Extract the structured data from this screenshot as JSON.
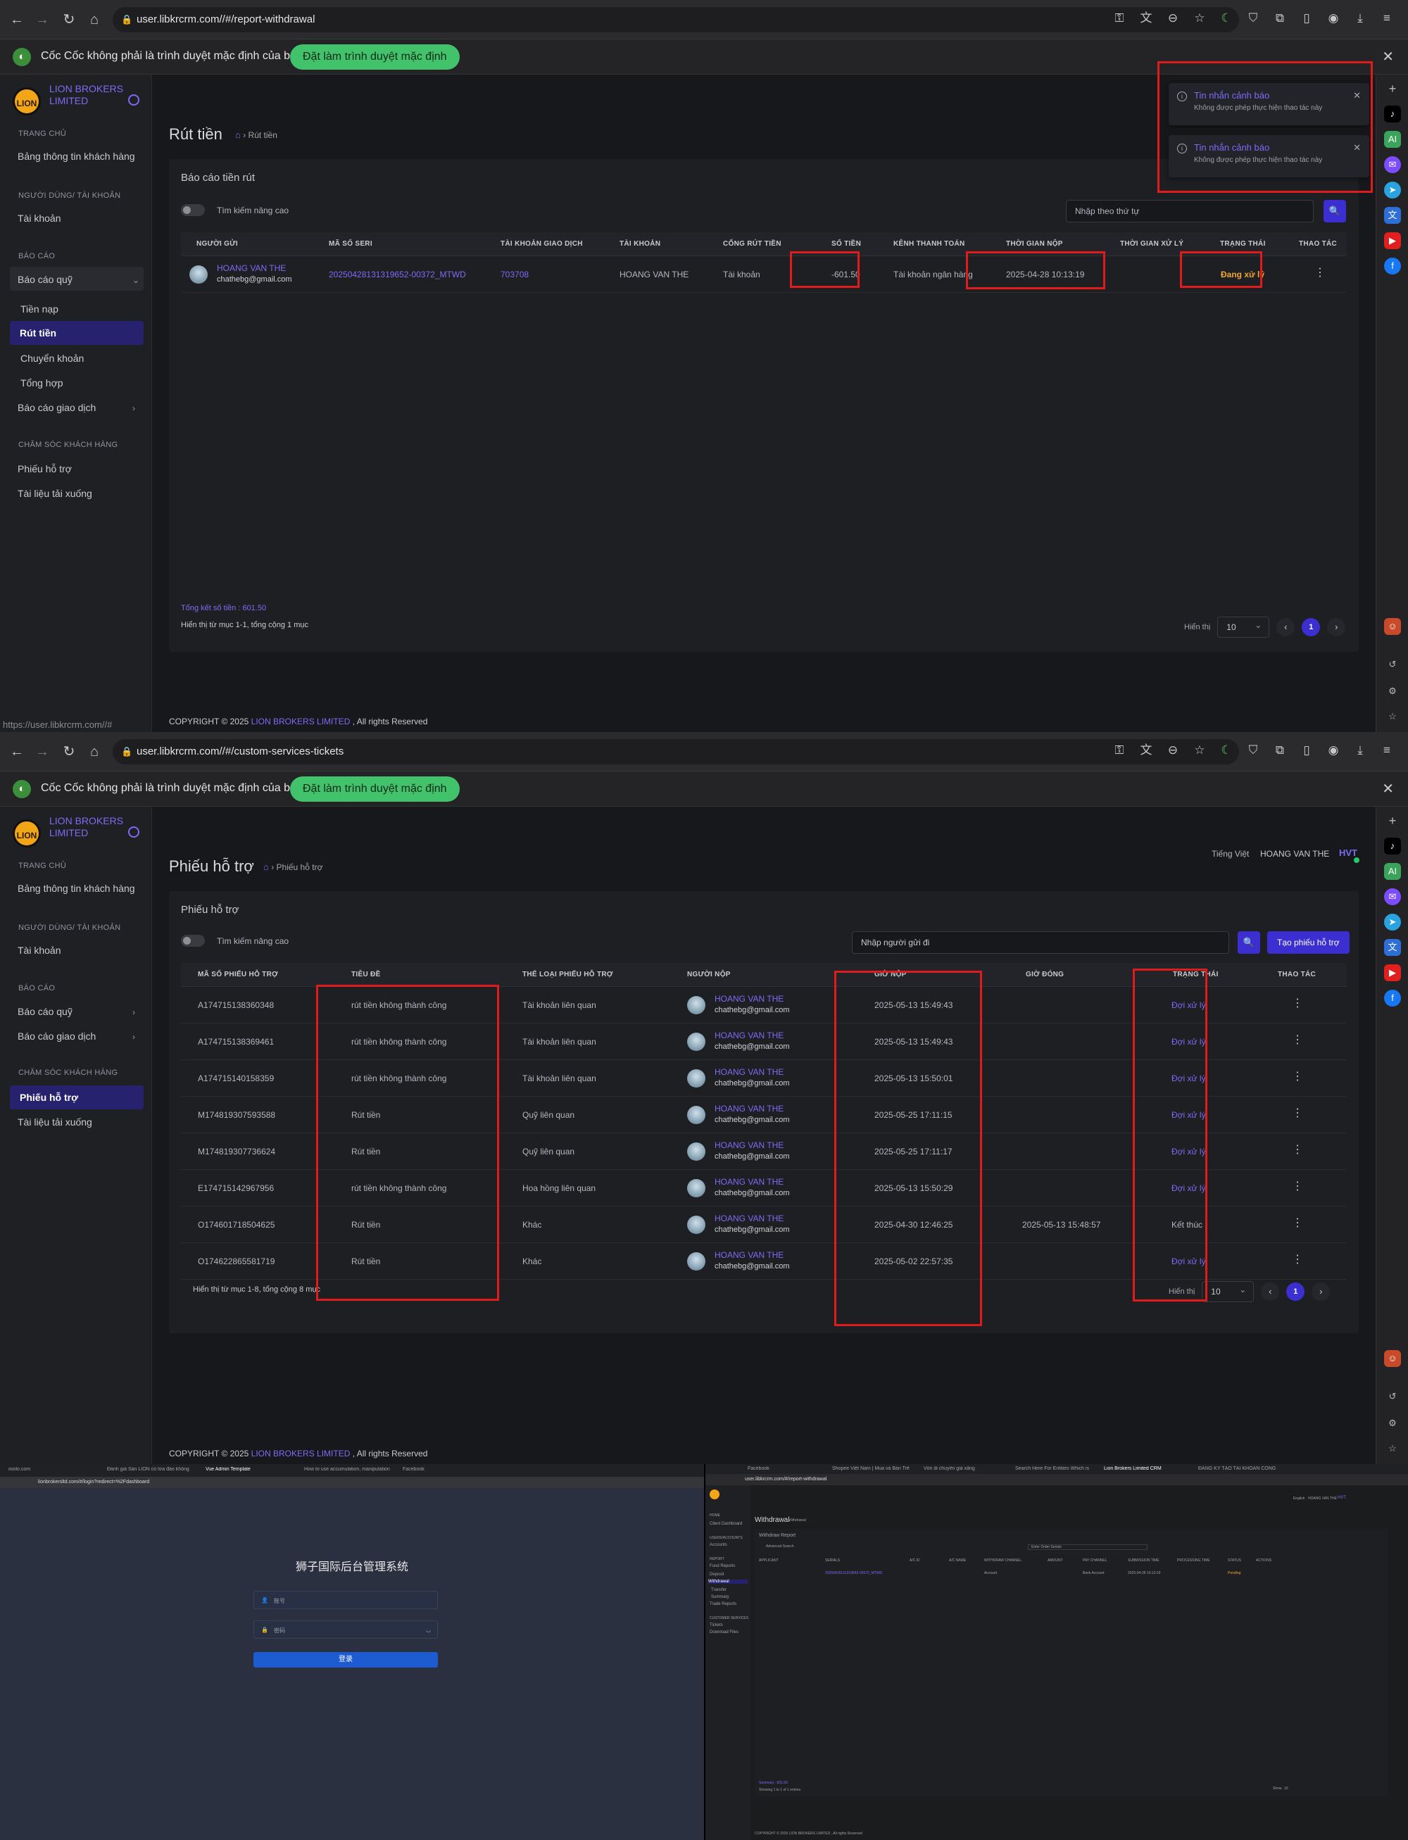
{
  "browser": {
    "url1": "user.libkrcrm.com//#/report-withdrawal",
    "url2": "user.libkrcrm.com//#/custom-services-tickets",
    "infobar_text": "Cốc Cốc không phải là trình duyệt mặc định của bạn",
    "infobar_button": "Đặt làm trình duyệt mặc định",
    "status_url": "https://user.libkrcrm.com//#"
  },
  "brand": {
    "name": "LION BROKERS LIMITED",
    "logo_text": "LION"
  },
  "sidebar": {
    "sec_home": "TRANG CHỦ",
    "dashboard": "Bảng thông tin khách hàng",
    "sec_users": "NGƯỜI DÙNG/ TÀI KHOẢN",
    "accounts": "Tài khoản",
    "sec_reports": "BÁO CÁO",
    "fund_report": "Báo cáo quỹ",
    "deposit": "Tiền nạp",
    "withdraw": "Rút tiền",
    "transfer": "Chuyển khoản",
    "summary": "Tổng hợp",
    "trade_report": "Báo cáo giao dịch",
    "sec_care": "CHĂM SÓC KHÁCH HÀNG",
    "tickets": "Phiếu hỗ trợ",
    "downloads": "Tài liệu tải xuống"
  },
  "header2": {
    "language": "Tiếng Việt",
    "user": "HOANG VAN THE",
    "initials": "HVT"
  },
  "withdraw": {
    "title": "Rút tiền",
    "breadcrumb": "Rút tiền",
    "card_title": "Báo cáo tiền rút",
    "advanced": "Tìm kiếm nâng cao",
    "search_placeholder": "Nhập theo thứ tự",
    "columns": [
      "NGƯỜI GỬI",
      "MÃ SỐ SERI",
      "TÀI KHOẢN GIAO DỊCH",
      "TÀI KHOẢN",
      "CỔNG RÚT TIỀN",
      "SỐ TIỀN",
      "KÊNH THANH TOÁN",
      "THỜI GIAN NỘP",
      "THỜI GIAN XỬ LÝ",
      "TRẠNG THÁI",
      "THAO TÁC"
    ],
    "row": {
      "name": "HOANG VAN THE",
      "email": "chathebg@gmail.com",
      "serial": "20250428131319652-00372_MTWD",
      "trade_account": "703708",
      "account": "HOANG VAN THE",
      "gateway": "Tài khoản",
      "amount": "-601.50",
      "channel": "Tài khoản ngân hàng",
      "submit_time": "2025-04-28 10:13:19",
      "process_time": "",
      "status": "Đang xử lý"
    },
    "total": "Tổng kết số tiền : 601.50",
    "showing": "Hiển thị từ mục 1-1, tổng cộng 1 mục",
    "per_page_label": "Hiển thị",
    "per_page": "10",
    "page": "1"
  },
  "notifications": [
    {
      "title": "Tin nhắn cảnh báo",
      "message": "Không được phép thực hiện thao tác này"
    },
    {
      "title": "Tin nhắn cảnh báo",
      "message": "Không được phép thực hiện thao tác này"
    }
  ],
  "tickets": {
    "title": "Phiếu hỗ trợ",
    "breadcrumb": "Phiếu hỗ trợ",
    "card_title": "Phiếu hỗ trợ",
    "advanced": "Tìm kiếm nâng cao",
    "search_placeholder": "Nhập người gửi đi",
    "create_button": "Tạo phiếu hỗ trợ",
    "columns": [
      "MÃ SỐ PHIẾU HỖ TRỢ",
      "TIÊU ĐỀ",
      "THỂ LOẠI PHIẾU HỖ TRỢ",
      "NGƯỜI NỘP",
      "GIỜ NỘP",
      "GIỜ ĐÓNG",
      "TRẠNG THÁI",
      "THAO TÁC"
    ],
    "rows": [
      {
        "id": "A174715138360348",
        "subject": "rút tiền không thành công",
        "type": "Tài khoản liên quan",
        "name": "HOANG VAN THE",
        "email": "chathebg@gmail.com",
        "submitted": "2025-05-13 15:49:43",
        "closed": "",
        "status": "Đợi xử lý"
      },
      {
        "id": "A174715138369461",
        "subject": "rút tiền không thành công",
        "type": "Tài khoản liên quan",
        "name": "HOANG VAN THE",
        "email": "chathebg@gmail.com",
        "submitted": "2025-05-13 15:49:43",
        "closed": "",
        "status": "Đợi xử lý"
      },
      {
        "id": "A174715140158359",
        "subject": "rút tiền không thành công",
        "type": "Tài khoản liên quan",
        "name": "HOANG VAN THE",
        "email": "chathebg@gmail.com",
        "submitted": "2025-05-13 15:50:01",
        "closed": "",
        "status": "Đợi xử lý"
      },
      {
        "id": "M174819307593588",
        "subject": "Rút tiền",
        "type": "Quỹ liên quan",
        "name": "HOANG VAN THE",
        "email": "chathebg@gmail.com",
        "submitted": "2025-05-25 17:11:15",
        "closed": "",
        "status": "Đợi xử lý"
      },
      {
        "id": "M174819307736624",
        "subject": "Rút tiền",
        "type": "Quỹ liên quan",
        "name": "HOANG VAN THE",
        "email": "chathebg@gmail.com",
        "submitted": "2025-05-25 17:11:17",
        "closed": "",
        "status": "Đợi xử lý"
      },
      {
        "id": "E174715142967956",
        "subject": "rút tiền không thành công",
        "type": "Hoa hồng liên quan",
        "name": "HOANG VAN THE",
        "email": "chathebg@gmail.com",
        "submitted": "2025-05-13 15:50:29",
        "closed": "",
        "status": "Đợi xử lý"
      },
      {
        "id": "O174601718504625",
        "subject": "Rút tiền",
        "type": "Khác",
        "name": "HOANG VAN THE",
        "email": "chathebg@gmail.com",
        "submitted": "2025-04-30 12:46:25",
        "closed": "2025-05-13 15:48:57",
        "status": "Kết thúc"
      },
      {
        "id": "O174622865581719",
        "subject": "Rút tiền",
        "type": "Khác",
        "name": "HOANG VAN THE",
        "email": "chathebg@gmail.com",
        "submitted": "2025-05-02 22:57:35",
        "closed": "",
        "status": "Đợi xử lý"
      }
    ],
    "showing": "Hiển thị từ mục 1-8, tổng cộng 8 mục",
    "per_page_label": "Hiển thị",
    "per_page": "10",
    "page": "1"
  },
  "footer": {
    "prefix": "COPYRIGHT © 2025",
    "brand": "LION BROKERS LIMITED",
    "suffix": ", All rights Reserved"
  },
  "login": {
    "tabs": [
      "ixiolo.com",
      "Đánh giá Sàn LION có lừa đảo không",
      "Vue Admin Template",
      "How to use accumulation, manipulation",
      "Facebook"
    ],
    "url": "lionbrokersltd.com/#/login?redirect=%2Fdashboard",
    "title": "狮子国际后台管理系统",
    "username_placeholder": "账号",
    "password_placeholder": "密码",
    "submit": "登录"
  },
  "mini": {
    "tabs": [
      "Facebook",
      "Shopee Việt Nam | Mua và Bán Trên",
      "Vốn di chuyển giá xăng",
      "Search Here For Entities Which is",
      "Lion Brokers Limited CRM",
      "ĐĂNG KÝ TẠO TÀI KHOẢN CÔNG"
    ],
    "url": "user.libkrcrm.com/#/report-withdrawal",
    "header": {
      "language": "English",
      "user": "HOANG VAN THE",
      "initials": "HVT"
    },
    "sidebar": [
      "HOME",
      "Client Dashboard",
      "USERS/ACCOUNTS",
      "Accounts",
      "REPORT",
      "Fund Reports",
      "Deposit",
      "Withdrawal",
      "Transfer",
      "Summary",
      "Trade Reports",
      "CUSTOMER SERVICES",
      "Tickets",
      "Download Files"
    ],
    "title": "Withdrawal",
    "breadcrumb": "Withdrawal",
    "card_title": "Withdraw Report",
    "advanced": "Advanced Search",
    "search_placeholder": "Enter Order Serials",
    "columns": [
      "APPLICANT",
      "SERIALS",
      "A/C ID",
      "A/C NAME",
      "WITHDRAW CHANNEL",
      "AMOUNT",
      "PAY CHANNEL",
      "SUBMISSION TIME",
      "PROCESSING TIME",
      "STATUS",
      "ACTIONS"
    ],
    "row": {
      "serial": "20250428131319652-00372_MTWD",
      "channel": "Account",
      "pay": "Bank Account",
      "time": "2025-04-28 10:13:19",
      "status": "Pending"
    },
    "summary": "Summary : 601.50",
    "showing": "Showing 1 to 1 of 1 entries",
    "show": "Show",
    "per_page": "10",
    "footer": "COPYRIGHT © 2025 LION BROKERS LIMITED , All rights Reserved"
  }
}
